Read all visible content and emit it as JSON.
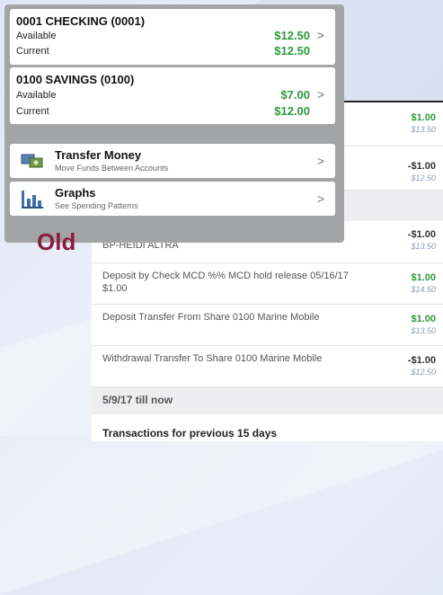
{
  "label": "Old",
  "old_screen": {
    "accounts": [
      {
        "name": "0001 CHECKING (0001)",
        "available_label": "Available",
        "available": "$12.50",
        "current_label": "Current",
        "current": "$12.50"
      },
      {
        "name": "0100 SAVINGS (0100)",
        "available_label": "Available",
        "available": "$7.00",
        "current_label": "Current",
        "current": "$12.00"
      }
    ],
    "menu": [
      {
        "title": "Transfer Money",
        "subtitle": "Move Funds Between Accounts",
        "icon": "transfer-icon"
      },
      {
        "title": "Graphs",
        "subtitle": "See Spending Patterns",
        "icon": "bar-chart-icon"
      }
    ]
  },
  "new_screen": {
    "top_rows": [
      {
        "amount": "$1.00",
        "balance": "$13.50",
        "positive": true
      },
      {
        "amount": "-$1.00",
        "balance": "$12.50",
        "positive": false
      }
    ],
    "transactions": [
      {
        "description": "Withdrawal INTERNET BANKING FVID-9854741.1.7 BP-HEIDI ALTRA",
        "amount": "-$1.00",
        "balance": "$13.50",
        "positive": false
      },
      {
        "description": "Deposit by Check MCD %% MCD hold release 05/16/17 $1.00",
        "amount": "$1.00",
        "balance": "$14.50",
        "positive": true
      },
      {
        "description": "Deposit Transfer From Share 0100 Marine Mobile",
        "amount": "$1.00",
        "balance": "$13.50",
        "positive": true
      },
      {
        "description": "Withdrawal Transfer To Share 0100 Marine Mobile",
        "amount": "-$1.00",
        "balance": "$12.50",
        "positive": false
      }
    ],
    "section_date": "5/9/17 till now",
    "section_previous": "Transactions for previous 15 days"
  },
  "colors": {
    "positive": "#2e9a3a",
    "label": "#8b1c3e",
    "balance": "#8a9bb8"
  }
}
